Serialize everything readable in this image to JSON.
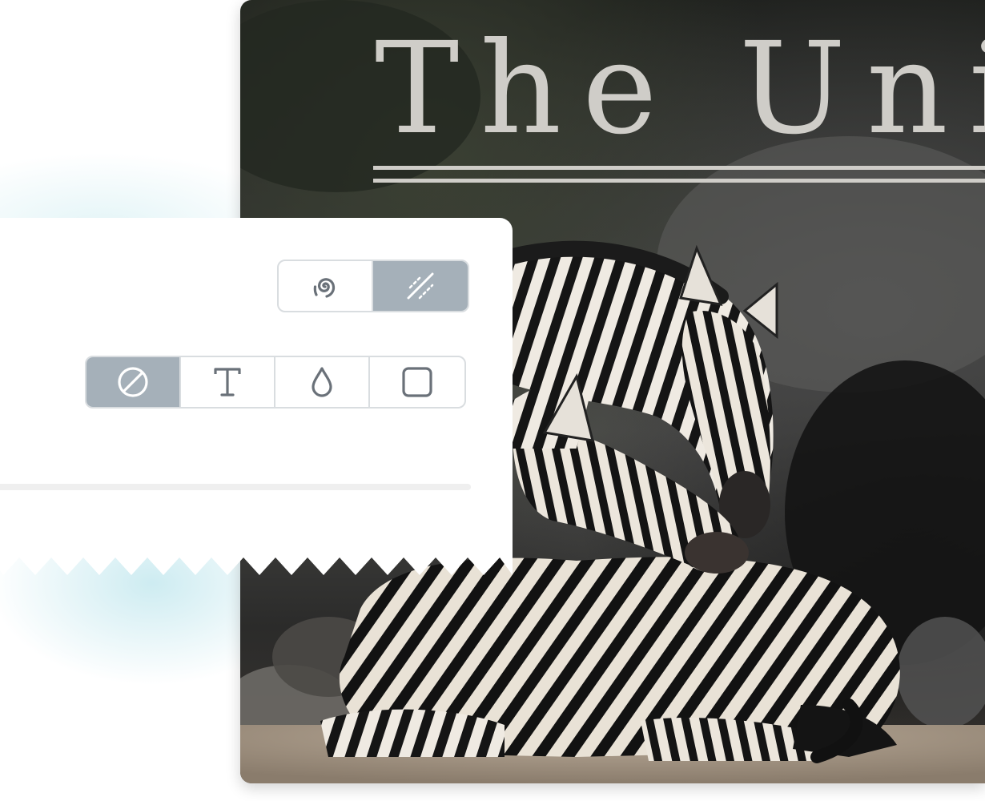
{
  "canvas": {
    "headline_text": "The Uniq",
    "accent_color": "#cfcdc8"
  },
  "toolbar": {
    "effect_group": [
      {
        "icon": "spiral-icon",
        "active": false
      },
      {
        "icon": "diagonal-lines-icon",
        "active": true
      }
    ],
    "mode_group": [
      {
        "icon": "none-icon",
        "active": true
      },
      {
        "icon": "text-icon",
        "active": false
      },
      {
        "icon": "drop-icon",
        "active": false
      },
      {
        "icon": "square-icon",
        "active": false
      }
    ],
    "active_color": "#a5b0b9",
    "border_color": "#d9dde0"
  }
}
